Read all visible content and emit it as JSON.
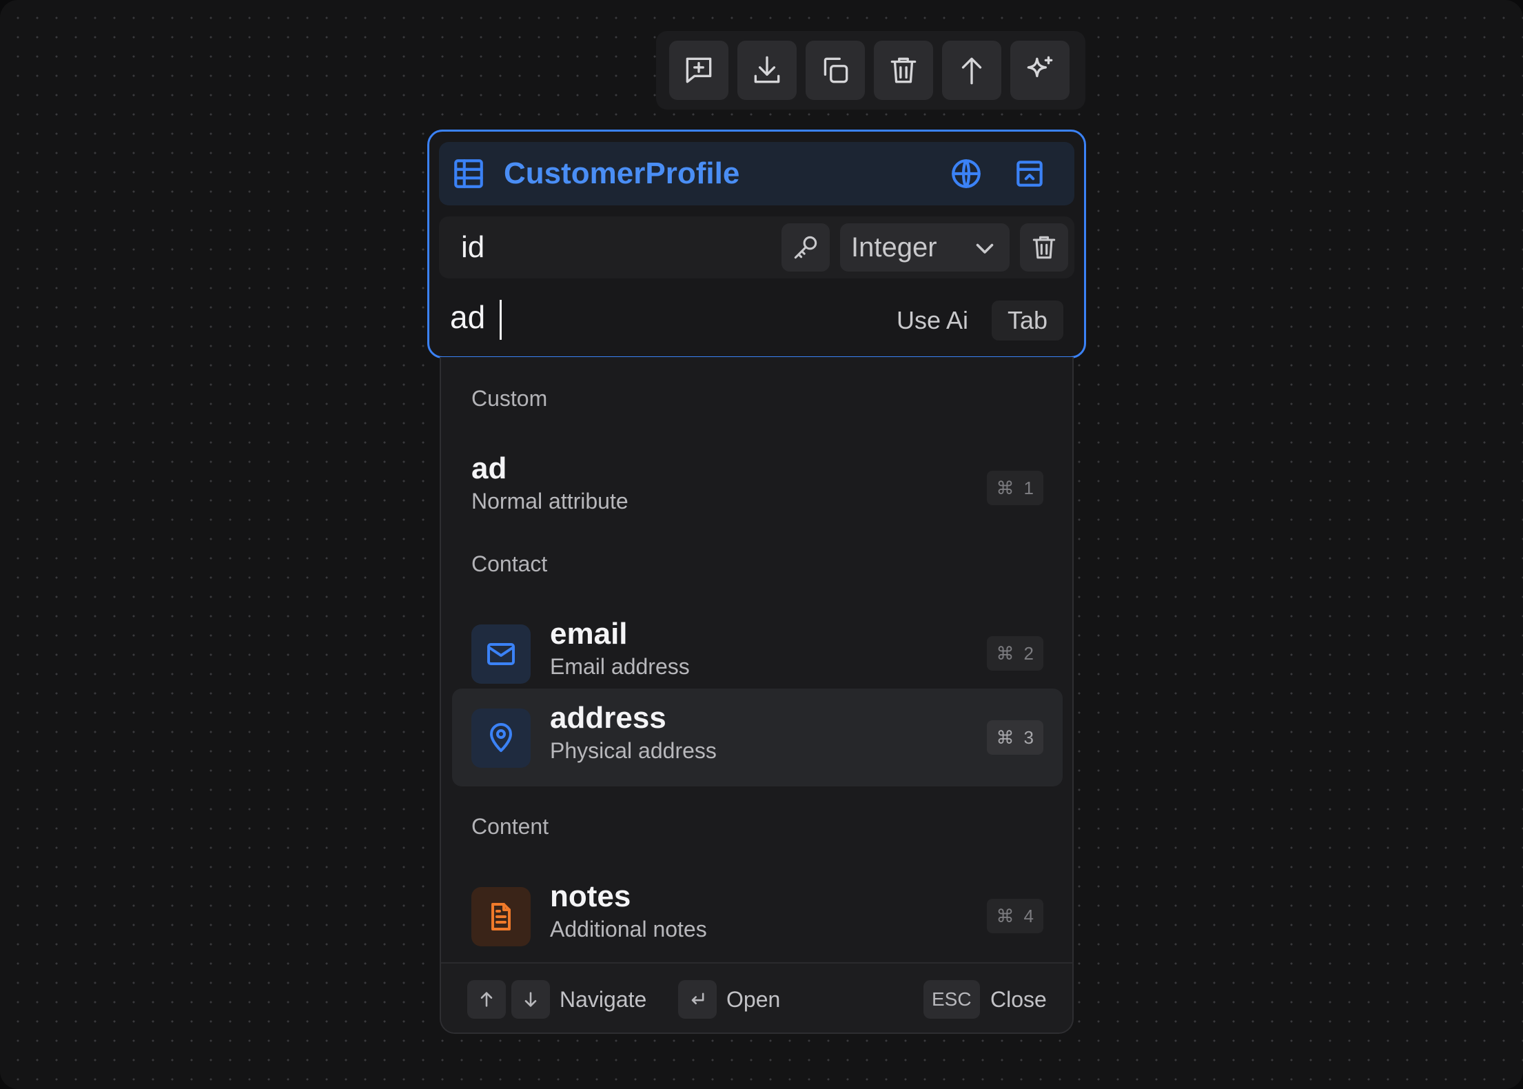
{
  "toolbar": {
    "buttons": [
      {
        "icon": "comment-plus-icon"
      },
      {
        "icon": "download-icon"
      },
      {
        "icon": "copy-icon"
      },
      {
        "icon": "trash-icon"
      },
      {
        "icon": "arrow-up-icon"
      },
      {
        "icon": "sparkles-icon"
      }
    ]
  },
  "table": {
    "name": "CustomerProfile",
    "accent_color": "#3b82f6",
    "fields": [
      {
        "name": "id",
        "type": "Integer",
        "primary_key_icon": "key-icon"
      }
    ],
    "new_field": {
      "value": "ad",
      "use_ai_label": "Use Ai",
      "tab_key": "Tab"
    }
  },
  "suggestions": {
    "groups": [
      {
        "label": "Custom",
        "options": [
          {
            "title": "ad",
            "subtitle": "Normal attribute",
            "shortcut_mod": "⌘",
            "shortcut_key": "1"
          }
        ]
      },
      {
        "label": "Contact",
        "options": [
          {
            "title": "email",
            "subtitle": "Email address",
            "icon": "mail-icon",
            "shortcut_mod": "⌘",
            "shortcut_key": "2"
          },
          {
            "title": "address",
            "subtitle": "Physical address",
            "icon": "map-pin-icon",
            "shortcut_mod": "⌘",
            "shortcut_key": "3",
            "highlighted": true
          }
        ]
      },
      {
        "label": "Content",
        "options": [
          {
            "title": "notes",
            "subtitle": "Additional notes",
            "icon": "file-text-icon",
            "shortcut_mod": "⌘",
            "shortcut_key": "4"
          }
        ]
      }
    ],
    "footer": {
      "navigate_label": "Navigate",
      "open_label": "Open",
      "esc_key": "ESC",
      "close_label": "Close"
    }
  }
}
